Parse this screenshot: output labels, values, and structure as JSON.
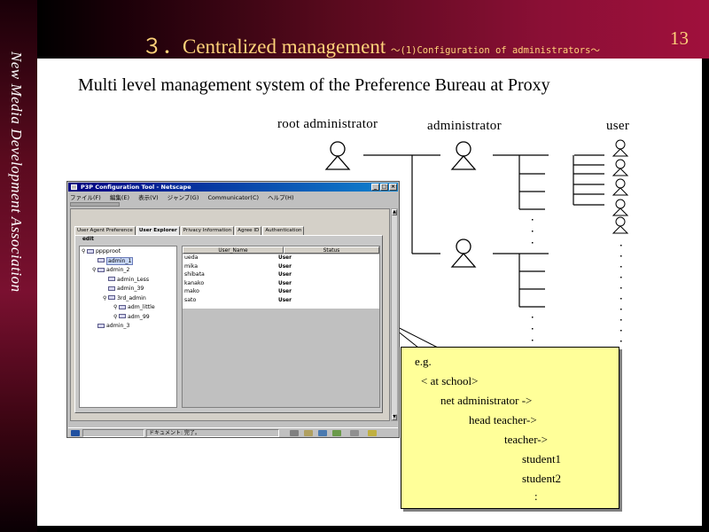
{
  "slide": {
    "side_text": "New Media Development Association",
    "title": "３．Centralized management",
    "title_sub": "～(1)Configuration of administrators～",
    "page_number": "13",
    "subtitle": "Multi level management system of the Preference Bureau at Proxy"
  },
  "hierarchy": {
    "root_label": "root administrator",
    "admin_label": "administrator",
    "user_label": "user"
  },
  "window": {
    "title": "P3P Configuration Tool - Netscape",
    "menus": [
      "ファイル(F)",
      "編集(E)",
      "表示(V)",
      "ジャンプ(G)",
      "Communicator(C)",
      "ヘルプ(H)"
    ],
    "tabs": [
      "User Agent Preference",
      "User Explorer",
      "Privacy Information",
      "Agree ID",
      "Authentication"
    ],
    "active_tab": "User Explorer",
    "edit_label": "edit",
    "tree": [
      {
        "label": "pppproot",
        "level": 0,
        "pin": true,
        "selected": false
      },
      {
        "label": "admin_1",
        "level": 1,
        "pin": false,
        "selected": true
      },
      {
        "label": "admin_2",
        "level": 1,
        "pin": true,
        "selected": false
      },
      {
        "label": "admin_Less",
        "level": 2,
        "pin": false,
        "selected": false
      },
      {
        "label": "admin_39",
        "level": 2,
        "pin": false,
        "selected": false
      },
      {
        "label": "3rd_admin",
        "level": 2,
        "pin": true,
        "selected": false
      },
      {
        "label": "adm_little",
        "level": 3,
        "pin": true,
        "selected": false
      },
      {
        "label": "adm_99",
        "level": 3,
        "pin": true,
        "selected": false
      },
      {
        "label": "admin_3",
        "level": 1,
        "pin": false,
        "selected": false
      }
    ],
    "list_columns": [
      "User_Name",
      "Status"
    ],
    "list_rows": [
      {
        "name": "ueda",
        "status": "User"
      },
      {
        "name": "mika",
        "status": "User"
      },
      {
        "name": "shibata",
        "status": "User"
      },
      {
        "name": "kanako",
        "status": "User"
      },
      {
        "name": "mako",
        "status": "User"
      },
      {
        "name": "sato",
        "status": "User"
      }
    ],
    "status_text": "ドキュメント: 完了。"
  },
  "callout": {
    "lines": [
      "e.g.",
      "< at school>",
      "net administrator ->",
      "head teacher->",
      "teacher->",
      "student1",
      "student2",
      ":"
    ]
  }
}
